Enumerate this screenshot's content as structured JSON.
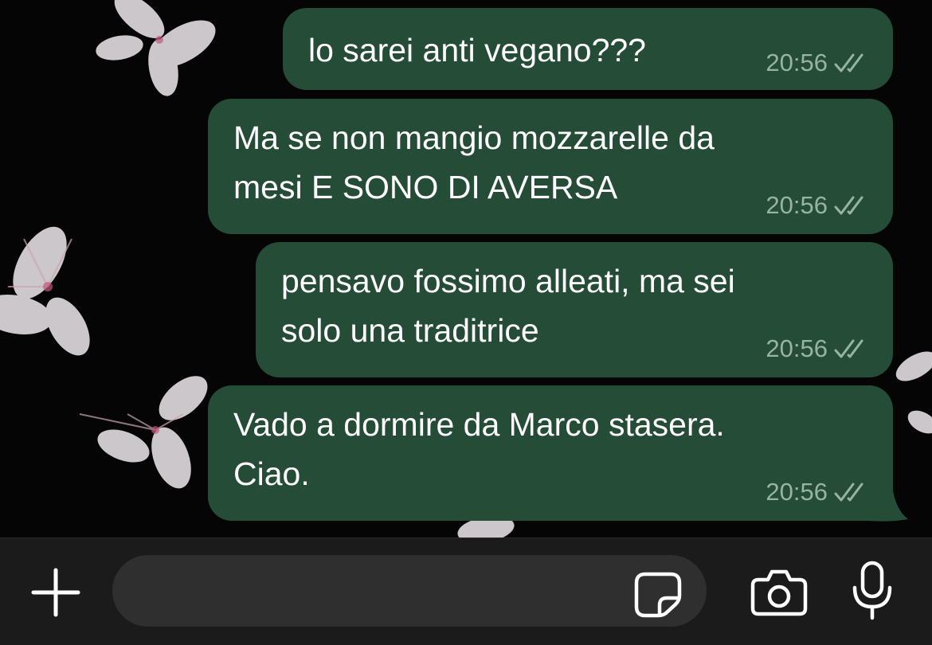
{
  "chat": {
    "messages": [
      {
        "text": "lo sarei anti vegano???",
        "time": "20:56",
        "status": "read",
        "status_icon": "double-check-icon"
      },
      {
        "text": "Ma se non mangio mozzarelle da\nmesi E SONO DI AVERSA",
        "time": "20:56",
        "status": "read",
        "status_icon": "double-check-icon"
      },
      {
        "text": "pensavo fossimo alleati, ma sei\nsolo una traditrice",
        "time": "20:56",
        "status": "read",
        "status_icon": "double-check-icon"
      },
      {
        "text": "Vado a dormire da Marco stasera.\nCiao.",
        "time": "20:56",
        "status": "read",
        "status_icon": "double-check-icon"
      }
    ]
  },
  "input_bar": {
    "message_placeholder": "",
    "icons": [
      "plus-icon",
      "sticker-icon",
      "camera-icon",
      "microphone-icon"
    ]
  },
  "colors": {
    "outgoing_bubble": "#254c37",
    "timestamp": "#97b3a2",
    "input_bar_background": "#1b1b1b",
    "input_field_background": "#2f2f2f",
    "chat_background": "#050505"
  }
}
